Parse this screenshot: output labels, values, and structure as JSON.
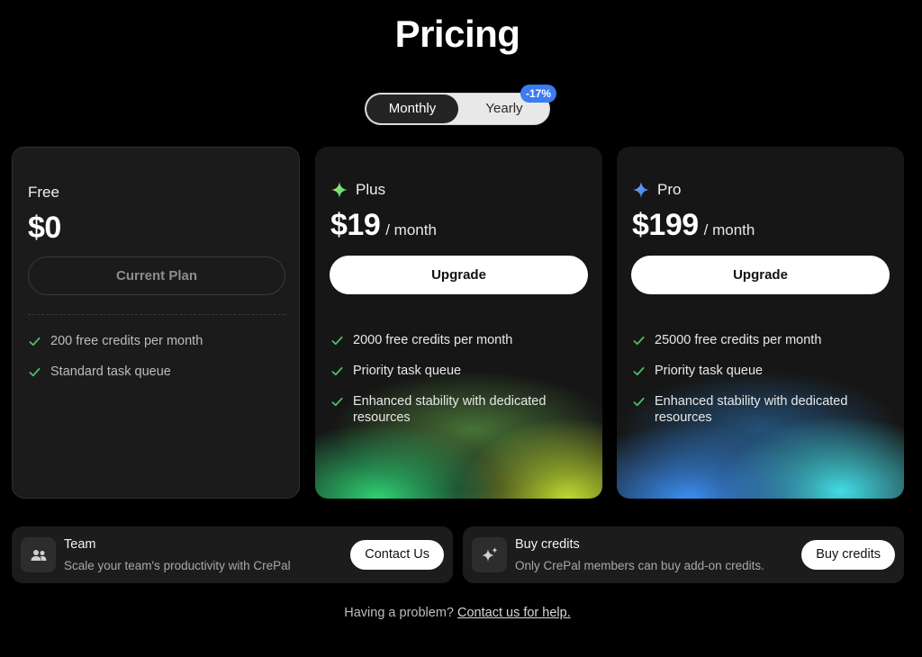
{
  "page": {
    "title": "Pricing"
  },
  "billing_toggle": {
    "monthly_label": "Monthly",
    "yearly_label": "Yearly",
    "discount_badge": "-17%",
    "selected": "Monthly"
  },
  "plans": [
    {
      "name": "Free",
      "price": "$0",
      "period": "",
      "button_label": "Current Plan",
      "features": [
        "200 free credits per month",
        "Standard task queue"
      ]
    },
    {
      "name": "Plus",
      "price": "$19",
      "period": "/ month",
      "button_label": "Upgrade",
      "icon": "sparkle-icon",
      "accent": "#5fe07a",
      "features": [
        "2000 free credits per month",
        "Priority task queue",
        "Enhanced stability with dedicated resources"
      ]
    },
    {
      "name": "Pro",
      "price": "$199",
      "period": "/ month",
      "button_label": "Upgrade",
      "icon": "sparkle-icon",
      "accent": "#3b7cf0",
      "features": [
        "25000 free credits per month",
        "Priority task queue",
        "Enhanced stability with dedicated resources"
      ]
    }
  ],
  "team": {
    "icon": "team-icon",
    "title": "Team",
    "description": "Scale your team's productivity with CrePal",
    "button_label": "Contact Us"
  },
  "credits": {
    "icon": "sparkle-icon",
    "title": "Buy credits",
    "description": "Only CrePal members can buy add-on credits.",
    "button_label": "Buy credits"
  },
  "help": {
    "text": "Having a problem?",
    "link_text": "Contact us for help."
  },
  "colors": {
    "background": "#000000",
    "card": "#161616",
    "check": "#4cc36a",
    "badge": "#3b7cf0"
  }
}
